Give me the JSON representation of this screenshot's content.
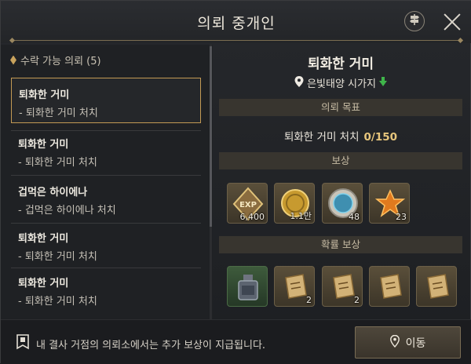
{
  "window": {
    "title": "의뢰 중개인"
  },
  "quest_list": {
    "header": "수락 가능 의뢰 (5)",
    "items": [
      {
        "title": "퇴화한 거미",
        "objective": "- 퇴화한 거미 처치",
        "selected": true
      },
      {
        "title": "퇴화한 거미",
        "objective": "- 퇴화한 거미 처치",
        "selected": false
      },
      {
        "title": "겁먹은 하이에나",
        "objective": "- 겁먹은 하이에나 처치",
        "selected": false
      },
      {
        "title": "퇴화한 거미",
        "objective": "- 퇴화한 거미 처치",
        "selected": false
      },
      {
        "title": "퇴화한 거미",
        "objective": "- 퇴화한 거미 처치",
        "selected": false
      }
    ]
  },
  "detail": {
    "title": "퇴화한 거미",
    "location": "은빛태양 시가지",
    "objective_header": "의뢰 목표",
    "objective_text": "퇴화한 거미 처치",
    "objective_progress": "0/150",
    "rewards_header": "보상",
    "rewards": [
      {
        "icon": "exp-icon",
        "quantity": "6,400"
      },
      {
        "icon": "gold-coin-icon",
        "quantity": "1.1만"
      },
      {
        "icon": "blue-orb-icon",
        "quantity": "48"
      },
      {
        "icon": "orange-gem-icon",
        "quantity": "23"
      }
    ],
    "chance_rewards_header": "확률 보상",
    "chance_rewards": [
      {
        "icon": "potion-bottle-icon",
        "quantity": ""
      },
      {
        "icon": "scroll-icon",
        "quantity": "2"
      },
      {
        "icon": "scroll-icon",
        "quantity": "2"
      },
      {
        "icon": "scroll-icon",
        "quantity": ""
      },
      {
        "icon": "scroll-icon",
        "quantity": ""
      }
    ]
  },
  "footer": {
    "notice": "내 결사 거점의 의뢰소에서는 추가 보상이 지급됩니다.",
    "move_button": "이동"
  },
  "colors": {
    "accent_gold": "#c39a54",
    "progress": "#e7c67c",
    "arrow_green": "#3fb54a"
  }
}
